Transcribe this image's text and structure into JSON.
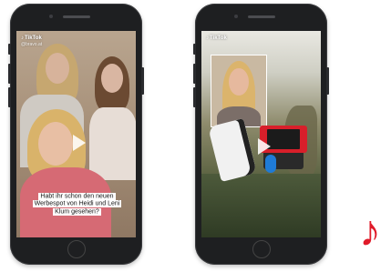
{
  "left_phone": {
    "app_name": "TikTok",
    "handle": "@bravo.at",
    "caption": "Habt ihr schon den neuen Werbespot von Heidi und Leni Klum gesehen?"
  },
  "right_phone": {
    "app_name": "TikTok"
  },
  "brand": {
    "icon": "tiktok-icon",
    "color": "#e01b2a",
    "glyph": "♪"
  }
}
